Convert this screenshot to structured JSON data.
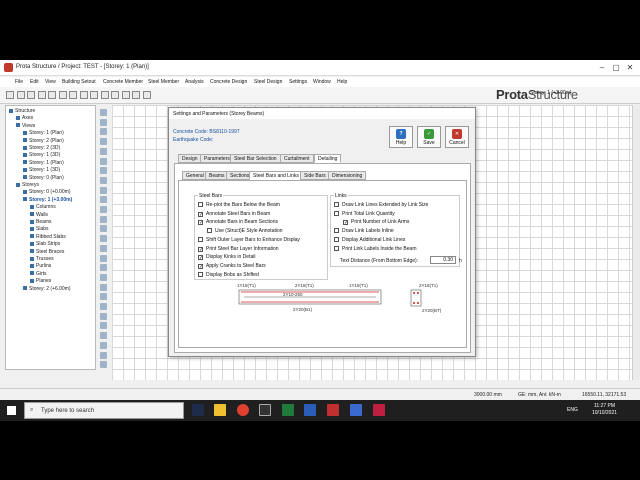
{
  "window": {
    "title": "Prota Structure / Project: TEST - [Storey: 1 (Plan)]"
  },
  "menu": [
    "File",
    "Edit",
    "View",
    "Building Setout",
    "Concrete Member",
    "Steel Member",
    "Analysis",
    "Concrete Design",
    "Steel Design",
    "Settings",
    "Window",
    "Help"
  ],
  "brand": {
    "prota": "Prota",
    "structure": "Structure"
  },
  "storey_selector": "Storey: 1 (+3.00m)",
  "tree": [
    {
      "label": "Structure",
      "indent": 0
    },
    {
      "label": "Axes",
      "indent": 1
    },
    {
      "label": "Views",
      "indent": 1
    },
    {
      "label": "Storey: 1 (Plan)",
      "indent": 2
    },
    {
      "label": "Storey: 2 (Plan)",
      "indent": 2
    },
    {
      "label": "Storey: 2 (3D)",
      "indent": 2
    },
    {
      "label": "Storey: 1 (3D)",
      "indent": 2
    },
    {
      "label": "Storey: 1 (Plan)",
      "indent": 2
    },
    {
      "label": "Storey: 1 (3D)",
      "indent": 2
    },
    {
      "label": "Storey: 0 (Plan)",
      "indent": 2
    },
    {
      "label": "Storeys",
      "indent": 1
    },
    {
      "label": "Storey: 0 (+0.00m)",
      "indent": 2
    },
    {
      "label": "Storey: 1 (+3.00m)",
      "indent": 2,
      "selected": true
    },
    {
      "label": "Columns",
      "indent": 3
    },
    {
      "label": "Walls",
      "indent": 3
    },
    {
      "label": "Beams",
      "indent": 3
    },
    {
      "label": "Slabs",
      "indent": 3
    },
    {
      "label": "Ribbed Slabs",
      "indent": 3
    },
    {
      "label": "Slab Strips",
      "indent": 3
    },
    {
      "label": "Steel Braces",
      "indent": 3
    },
    {
      "label": "Trusses",
      "indent": 3
    },
    {
      "label": "Purlins",
      "indent": 3
    },
    {
      "label": "Girts",
      "indent": 3
    },
    {
      "label": "Planes",
      "indent": 3
    },
    {
      "label": "Storey: 2 (+6.00m)",
      "indent": 2
    }
  ],
  "dialog": {
    "title": "Settings and Parameters (Storey Beams)",
    "concrete_code": "Concrete Code: BS8110-1997",
    "earthquake_code": "Earthquake Code:",
    "help_label": "Help",
    "save_label": "Save",
    "cancel_label": "Cancel",
    "tabs": [
      "Design",
      "Parameters",
      "Steel Bar Selection",
      "Curtailment",
      "Detailing"
    ],
    "subtabs": [
      "General",
      "Beams",
      "Sections",
      "Steel Bars and Links",
      "Side Bars",
      "Dimensioning"
    ],
    "steel_bars_title": "Steel Bars",
    "steel_bars": [
      {
        "label": "Re-plot the Bars Below the Beam",
        "checked": false
      },
      {
        "label": "Annotate Steel Bars in Beam",
        "checked": true
      },
      {
        "label": "Annotate Bars in Beam Sections",
        "checked": true
      },
      {
        "label": "Use (Struct)E Style Annotation",
        "checked": false
      },
      {
        "label": "Shift Outer Layer Bars to Enhance Display",
        "checked": false
      },
      {
        "label": "Print Steel Bar Layer Information",
        "checked": true
      },
      {
        "label": "Display Kinks in Detail",
        "checked": true
      },
      {
        "label": "Apply Cranks to Steel Bars",
        "checked": true
      },
      {
        "label": "Display Bobs as Shifted",
        "checked": false
      }
    ],
    "links_title": "Links",
    "links": [
      {
        "label": "Draw Link Lines Extended by Link Size",
        "checked": false
      },
      {
        "label": "Print Total Link Quantity",
        "checked": false
      },
      {
        "label": "Print Number of Link Arms",
        "checked": true
      },
      {
        "label": "Draw Link Labels Inline",
        "checked": false
      },
      {
        "label": "Display Additional Link Lines",
        "checked": false
      },
      {
        "label": "Print Link Labels Inside the Beam",
        "checked": false
      }
    ],
    "text_distance_label": "Text Distance (From Bottom Edge):",
    "text_distance_value": "0.30",
    "text_distance_unit": "h",
    "preview": {
      "top_bar_left": "1Y18(T1)",
      "top_bar_mid": "2Y18(T1)",
      "top_bar_right": "1Y18(T1)",
      "link_label": "2Y10-250",
      "bottom_bar": "2Y20(B1)",
      "section_top": "2Y18(T1)",
      "section_bottom": "2Y20(BT)"
    }
  },
  "status": {
    "size": "3000.00 mm",
    "units": "GE: mm, Ani: kN-m",
    "coords": "16550.11, 32171.53"
  },
  "taskbar": {
    "search_placeholder": "Type here to search",
    "language": "ENG",
    "time": "11:27 PM",
    "date": "10/10/2021"
  }
}
